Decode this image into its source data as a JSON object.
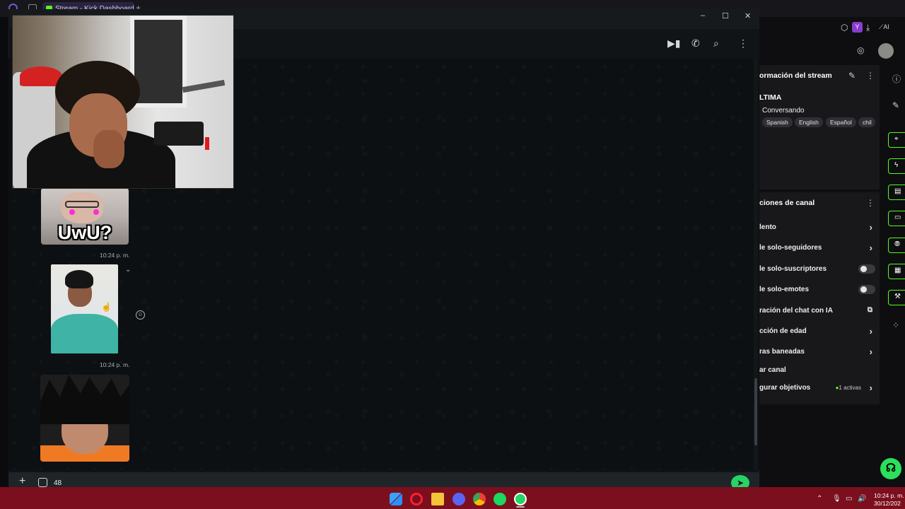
{
  "browser": {
    "tab_title": "Stream - Kick Dashboard",
    "new_tab": "+"
  },
  "whatsapp": {
    "window_controls": {
      "minimize": "–",
      "maximize": "☐",
      "close": "✕"
    },
    "header_icons": [
      "video-icon",
      "phone-icon",
      "search-icon",
      "menu-icon"
    ],
    "messages": [
      {
        "type": "image",
        "caption_text": "UwU?",
        "time": "10:24 p. m."
      },
      {
        "type": "image",
        "time": "10:24 p. m."
      },
      {
        "type": "image"
      }
    ],
    "compose": {
      "value": "48",
      "placeholder": ""
    }
  },
  "kick": {
    "stream_info": {
      "title": "ormación del stream",
      "subtitle": "LTIMA",
      "category": "Conversando",
      "tags": [
        "Spanish",
        "English",
        "Español",
        "chil"
      ]
    },
    "channel_actions": {
      "title": "ciones de canal",
      "rows": [
        {
          "label": "lento",
          "control": "chevron"
        },
        {
          "label": "le solo-seguidores",
          "control": "chevron"
        },
        {
          "label": "le solo-suscriptores",
          "control": "toggle"
        },
        {
          "label": "le solo-emotes",
          "control": "toggle"
        },
        {
          "label": "ración del chat con IA",
          "control": "external"
        },
        {
          "label": "cción de edad",
          "control": "chevron"
        },
        {
          "label": "ras baneadas",
          "control": "chevron"
        },
        {
          "label": "ar canal",
          "control": "none"
        },
        {
          "label": "gurar objetivos",
          "control": "chevron",
          "badge": "1 activas"
        }
      ]
    },
    "profile_letter": "Y",
    "ai_label": "AI"
  },
  "taskbar": {
    "apps": [
      "windows-start",
      "opera",
      "file-explorer",
      "discord",
      "chrome",
      "spotify",
      "whatsapp"
    ],
    "time": "10:24 p. m.",
    "date": "30/12/202"
  },
  "colors": {
    "kick_green": "#53fc18",
    "whatsapp_green": "#25d366",
    "taskbar": "#7b0f1e"
  }
}
